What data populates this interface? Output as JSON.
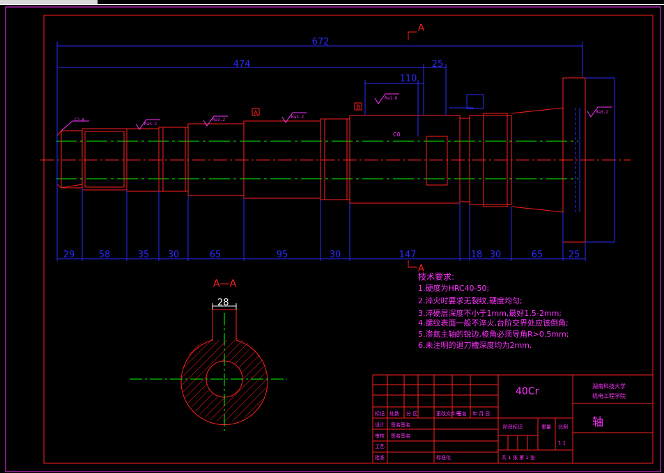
{
  "drawing": {
    "colors": {
      "red": "#ff2020",
      "blue": "#2b2bff",
      "green": "#00ff00",
      "magenta": "#ff33ff",
      "white": "#ffffff",
      "cyan": "#00ffff"
    },
    "overall_dims": {
      "total": "672",
      "left_part": "474",
      "small_right": "25",
      "section_width": "110"
    },
    "section_marks": {
      "top": "A",
      "bottom": "A",
      "datum_a": "A",
      "datum_b": "B"
    },
    "roughness": [
      "Ra3.2",
      "Ra3.2",
      "Ra3.2",
      "Ra1.6",
      "Ra3.2"
    ],
    "chamfer": "C2.0",
    "c0_label": "C0",
    "segment_dims": [
      "29",
      "58",
      "35",
      "30",
      "65",
      "95",
      "30",
      "147",
      "18",
      "30",
      "65",
      "25"
    ],
    "section_title": "A—A",
    "keyway_width": "28",
    "tech_title": "技术要求:",
    "tech_items": [
      "1.硬度为HRC40-50;",
      "2.淬火时要求无裂纹,硬度均匀;",
      "3.淬硬层深度不小于1mm,最好1.5-2mm;",
      "4.螺纹表面一般不淬火,台阶交界处应该倒角;",
      "5.渗氮主轴的锐边,棱角必须导角R>0.5mm;",
      "6.未注明的退刀槽深度均为2mm."
    ]
  },
  "title_block": {
    "material": "40Cr",
    "school": "湖南科技大学",
    "dept": "机电工程学院",
    "part_name": "轴",
    "labels": [
      "标记",
      "处数",
      "分 区",
      "更改文件号",
      "签名",
      "年 月 日"
    ],
    "design": "设计",
    "check": "审核",
    "process": "工艺",
    "standard": "标准化",
    "approve": "批准",
    "stage": "阶段标记",
    "weight": "重量",
    "scale": "比例",
    "scale_val": "1:1",
    "sheet": "共 1 张 第 1 张",
    "signer": "签名签名"
  }
}
